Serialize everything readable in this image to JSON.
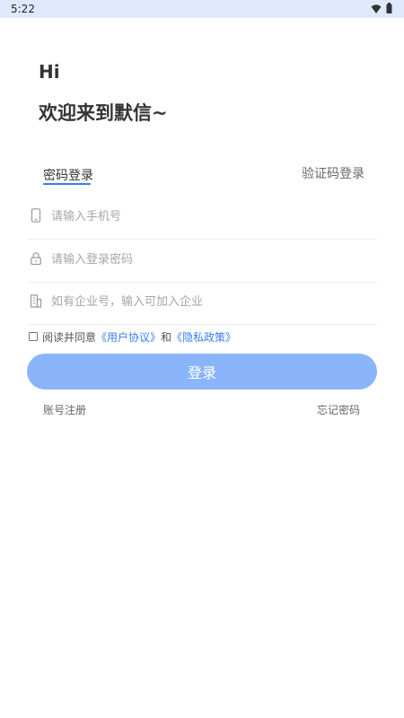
{
  "status_bar": {
    "time": "5:22",
    "wifi_icon": "wifi-icon",
    "battery_icon": "battery-icon",
    "background": "#dfe9fb"
  },
  "greeting": {
    "hi": "Hi",
    "welcome": "欢迎来到默信~"
  },
  "tabs": {
    "password_login": "密码登录",
    "code_login": "验证码登录",
    "active": "password_login",
    "accent": "#3a7bf0"
  },
  "form": {
    "phone": {
      "placeholder": "请输入手机号",
      "value": "",
      "icon": "phone-icon"
    },
    "password": {
      "placeholder": "请输入登录密码",
      "value": "",
      "icon": "lock-icon"
    },
    "company": {
      "placeholder": "如有企业号，输入可加入企业",
      "value": "",
      "icon": "building-icon"
    }
  },
  "agreement": {
    "checked": false,
    "prefix": "阅读并同意",
    "user_agreement": "《用户协议》",
    "and": "和",
    "privacy_policy": "《隐私政策》"
  },
  "actions": {
    "login": "登录",
    "login_color": "#8ab5fb",
    "register": "账号注册",
    "forgot_password": "忘记密码"
  }
}
